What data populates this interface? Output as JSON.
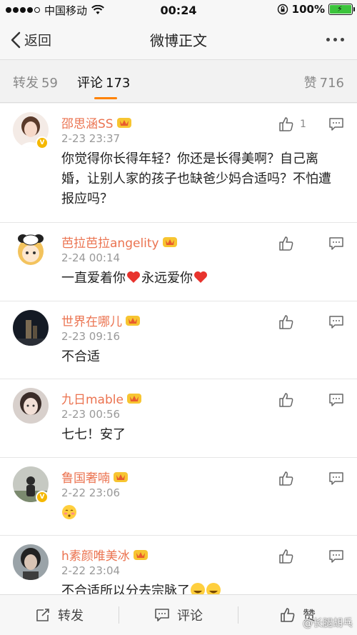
{
  "status_bar": {
    "carrier": "中国移动",
    "time": "00:24",
    "battery": "100%",
    "battery_level": 1.0,
    "battery_color": "#3cc43c"
  },
  "nav": {
    "back_label": "返回",
    "title": "微博正文",
    "more_icon": "more-dots-icon"
  },
  "tabs": {
    "repost_label": "转发",
    "repost_count": "59",
    "comment_label": "评论",
    "comment_count": "173",
    "like_label": "赞",
    "like_count": "716",
    "active_color": "#ff8200"
  },
  "comments": [
    {
      "username": "邵思涵SS",
      "time": "2-23 23:37",
      "text": "你觉得你长得年轻？你还是长得美啊？自己离婚，让别人家的孩子也缺爸少妈合适吗？不怕遭报应吗？",
      "likes": "1",
      "verified": true
    },
    {
      "username": "芭拉芭拉angelity",
      "time": "2-24 00:14",
      "text_parts": [
        "一直爱着你",
        "永远爱你"
      ],
      "likes": ""
    },
    {
      "username": "世界在哪儿",
      "time": "2-23 09:16",
      "text": "不合适",
      "likes": ""
    },
    {
      "username": "九日mable",
      "time": "2-23 00:56",
      "text": "七七！安了",
      "likes": ""
    },
    {
      "username": "鲁国奢喃",
      "time": "2-22 23:06",
      "text": "",
      "likes": "",
      "verified": true
    },
    {
      "username": "h素颜唯美冰",
      "time": "2-22 23:04",
      "text": "不合适所以分去宗脉了",
      "likes": ""
    }
  ],
  "bottom_bar": {
    "repost_label": "转发",
    "comment_label": "评论",
    "like_label": "赞"
  },
  "watermark": "@长腿胡乓",
  "colors": {
    "username": "#eb7350",
    "accent": "#ff8200",
    "heart": "#e8332d"
  }
}
